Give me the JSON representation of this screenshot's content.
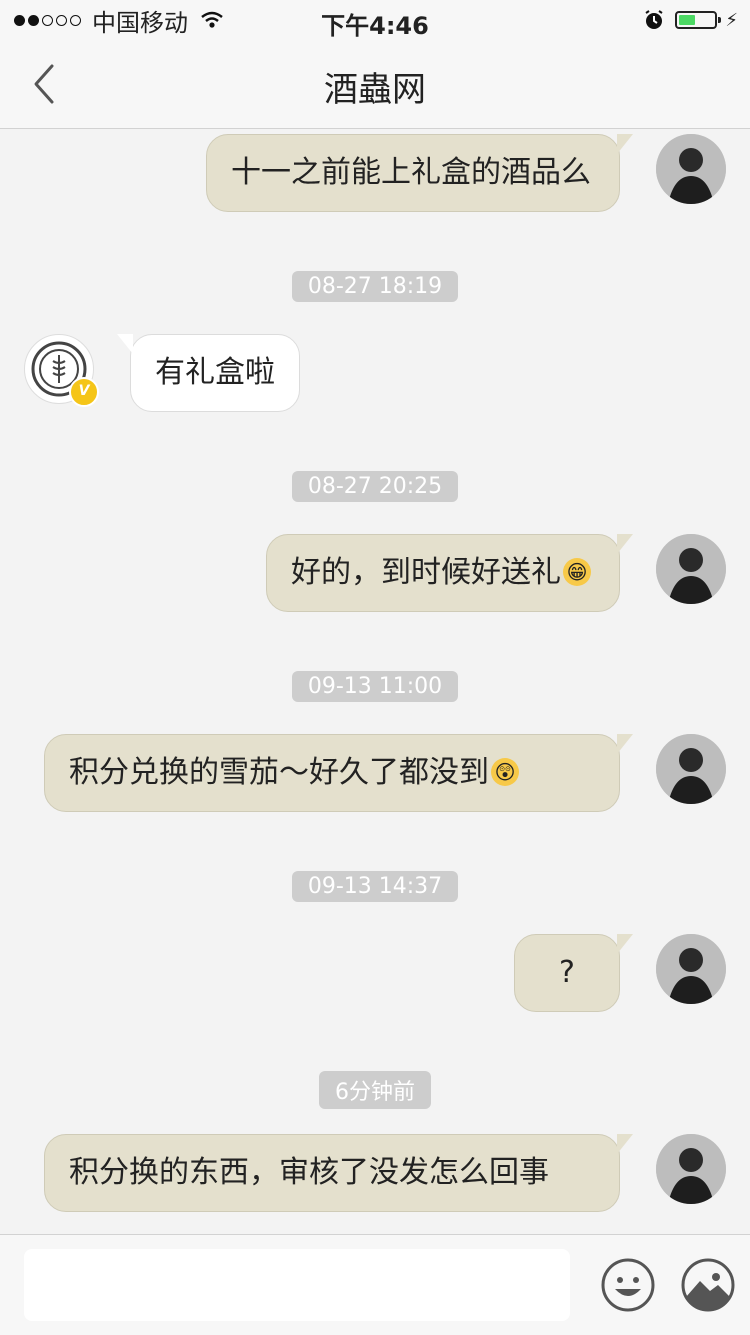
{
  "status_bar": {
    "carrier": "中国移动",
    "time": "下午4:46"
  },
  "nav": {
    "title": "酒蟲网"
  },
  "messages": [
    {
      "sender": "me",
      "text": "十一之前能上礼盒的酒品么"
    },
    {
      "time": "08-27 18:19"
    },
    {
      "sender": "them",
      "text": "有礼盒啦"
    },
    {
      "time": "08-27 20:25"
    },
    {
      "sender": "me",
      "text": "好的，到时候好送礼",
      "emoji": "grin-emoji"
    },
    {
      "time": "09-13 11:00"
    },
    {
      "sender": "me",
      "text": "积分兑换的雪茄～好久了都没到",
      "emoji": "surprised-emoji"
    },
    {
      "time": "09-13 14:37"
    },
    {
      "sender": "me",
      "text": "?"
    },
    {
      "time": "6分钟前"
    },
    {
      "sender": "me",
      "text": "积分换的东西，审核了没发怎么回事"
    }
  ],
  "input": {
    "value": "",
    "placeholder": ""
  },
  "icons": {
    "emoji_button": "smiley-icon",
    "image_button": "image-icon",
    "back": "chevron-left-icon",
    "verified": "verified-badge-icon"
  },
  "colors": {
    "my_bubble": "#e4e0cd",
    "their_bubble": "#ffffff",
    "timestamp_bg": "#cdcdcd",
    "verified_badge": "#f5c518",
    "battery": "#4cd964"
  }
}
